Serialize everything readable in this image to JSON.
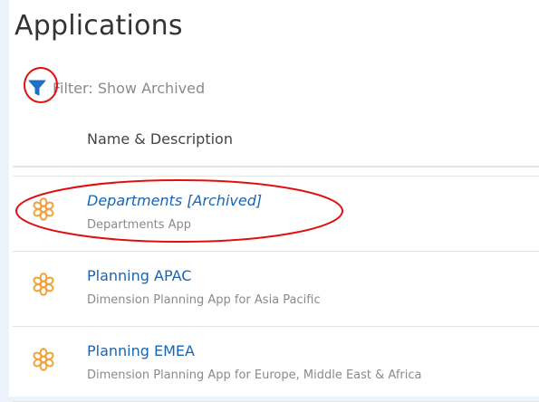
{
  "page": {
    "title": "Applications"
  },
  "filter": {
    "icon": "filter-icon",
    "label": "Filter: Show Archived"
  },
  "table": {
    "column_header": "Name & Description"
  },
  "applications": [
    {
      "name": "Departments [Archived]",
      "description": "Departments App",
      "archived": true,
      "icon": "application-flower-icon"
    },
    {
      "name": "Planning APAC",
      "description": "Dimension Planning App for Asia Pacific",
      "archived": false,
      "icon": "application-flower-icon"
    },
    {
      "name": "Planning EMEA",
      "description": "Dimension Planning App for Europe, Middle East & Africa",
      "archived": false,
      "icon": "application-flower-icon"
    }
  ],
  "colors": {
    "link": "#1a64b0",
    "muted": "#8a8a8a",
    "icon_orange": "#f0a33a",
    "filter_blue": "#1f6fc5",
    "annotation_red": "#e01010",
    "page_bg": "#edf3fa"
  }
}
